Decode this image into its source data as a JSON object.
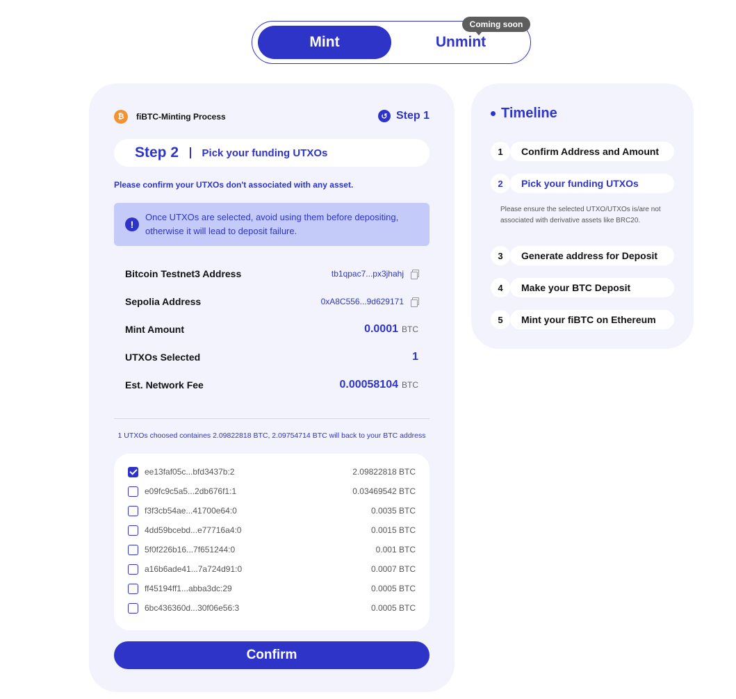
{
  "toggle": {
    "mint": "Mint",
    "unmint": "Unmint",
    "badge": "Coming soon"
  },
  "process": {
    "title": "fiBTC-Minting Process",
    "coin_icon": "bitcoin-icon",
    "step_link": "Step 1",
    "step_num": "Step 2",
    "step_title": "Pick your funding UTXOs",
    "confirm_note": "Please confirm your UTXOs don't associated with any asset.",
    "alert": "Once UTXOs are selected, avoid using them before depositing, otherwise it will lead to deposit failure."
  },
  "info": {
    "btc_addr_label": "Bitcoin Testnet3 Address",
    "btc_addr": "tb1qpac7...px3jhahj",
    "sep_addr_label": "Sepolia Address",
    "sep_addr": "0xA8C556...9d629171",
    "mint_label": "Mint Amount",
    "mint_value": "0.0001",
    "utxo_label": "UTXOs Selected",
    "utxo_value": "1",
    "fee_label": "Est. Network Fee",
    "fee_value": "0.00058104",
    "unit": "BTC"
  },
  "back_note": "1 UTXOs choosed containes 2.09822818 BTC, 2.09754714 BTC will back to your BTC address",
  "utxos": [
    {
      "id": "ee13faf05c...bfd3437b:2",
      "amount": "2.09822818 BTC",
      "checked": true
    },
    {
      "id": "e09fc9c5a5...2db676f1:1",
      "amount": "0.03469542 BTC",
      "checked": false
    },
    {
      "id": "f3f3cb54ae...41700e64:0",
      "amount": "0.0035 BTC",
      "checked": false
    },
    {
      "id": "4dd59bcebd...e77716a4:0",
      "amount": "0.0015 BTC",
      "checked": false
    },
    {
      "id": "5f0f226b16...7f651244:0",
      "amount": "0.001 BTC",
      "checked": false
    },
    {
      "id": "a16b6ade41...7a724d91:0",
      "amount": "0.0007 BTC",
      "checked": false
    },
    {
      "id": "ff45194ff1...abba3dc:29",
      "amount": "0.0005 BTC",
      "checked": false
    },
    {
      "id": "6bc436360d...30f06e56:3",
      "amount": "0.0005 BTC",
      "checked": false
    }
  ],
  "confirm": "Confirm",
  "timeline": {
    "title": "Timeline",
    "items": [
      {
        "num": "1",
        "label": "Confirm Address and Amount"
      },
      {
        "num": "2",
        "label": "Pick your funding UTXOs"
      },
      {
        "num": "3",
        "label": "Generate address for Deposit"
      },
      {
        "num": "4",
        "label": "Make your BTC Deposit"
      },
      {
        "num": "5",
        "label": "Mint your fiBTC on Ethereum"
      }
    ],
    "note": "Please ensure the selected UTXO/UTXOs is/are not associated with derivative assets like BRC20."
  },
  "colors": {
    "accent": "#2e34c8",
    "card_bg": "#f2f3fd",
    "alert_bg": "#c5cbf8"
  }
}
